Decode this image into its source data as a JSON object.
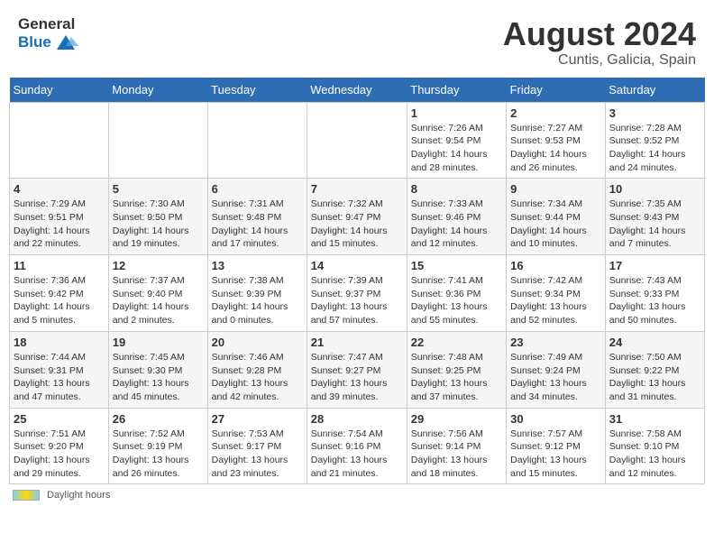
{
  "logo": {
    "general": "General",
    "blue": "Blue"
  },
  "title": "August 2024",
  "subtitle": "Cuntis, Galicia, Spain",
  "days_of_week": [
    "Sunday",
    "Monday",
    "Tuesday",
    "Wednesday",
    "Thursday",
    "Friday",
    "Saturday"
  ],
  "footer_label": "Daylight hours",
  "weeks": [
    [
      {
        "day": "",
        "info": ""
      },
      {
        "day": "",
        "info": ""
      },
      {
        "day": "",
        "info": ""
      },
      {
        "day": "",
        "info": ""
      },
      {
        "day": "1",
        "info": "Sunrise: 7:26 AM\nSunset: 9:54 PM\nDaylight: 14 hours and 28 minutes."
      },
      {
        "day": "2",
        "info": "Sunrise: 7:27 AM\nSunset: 9:53 PM\nDaylight: 14 hours and 26 minutes."
      },
      {
        "day": "3",
        "info": "Sunrise: 7:28 AM\nSunset: 9:52 PM\nDaylight: 14 hours and 24 minutes."
      }
    ],
    [
      {
        "day": "4",
        "info": "Sunrise: 7:29 AM\nSunset: 9:51 PM\nDaylight: 14 hours and 22 minutes."
      },
      {
        "day": "5",
        "info": "Sunrise: 7:30 AM\nSunset: 9:50 PM\nDaylight: 14 hours and 19 minutes."
      },
      {
        "day": "6",
        "info": "Sunrise: 7:31 AM\nSunset: 9:48 PM\nDaylight: 14 hours and 17 minutes."
      },
      {
        "day": "7",
        "info": "Sunrise: 7:32 AM\nSunset: 9:47 PM\nDaylight: 14 hours and 15 minutes."
      },
      {
        "day": "8",
        "info": "Sunrise: 7:33 AM\nSunset: 9:46 PM\nDaylight: 14 hours and 12 minutes."
      },
      {
        "day": "9",
        "info": "Sunrise: 7:34 AM\nSunset: 9:44 PM\nDaylight: 14 hours and 10 minutes."
      },
      {
        "day": "10",
        "info": "Sunrise: 7:35 AM\nSunset: 9:43 PM\nDaylight: 14 hours and 7 minutes."
      }
    ],
    [
      {
        "day": "11",
        "info": "Sunrise: 7:36 AM\nSunset: 9:42 PM\nDaylight: 14 hours and 5 minutes."
      },
      {
        "day": "12",
        "info": "Sunrise: 7:37 AM\nSunset: 9:40 PM\nDaylight: 14 hours and 2 minutes."
      },
      {
        "day": "13",
        "info": "Sunrise: 7:38 AM\nSunset: 9:39 PM\nDaylight: 14 hours and 0 minutes."
      },
      {
        "day": "14",
        "info": "Sunrise: 7:39 AM\nSunset: 9:37 PM\nDaylight: 13 hours and 57 minutes."
      },
      {
        "day": "15",
        "info": "Sunrise: 7:41 AM\nSunset: 9:36 PM\nDaylight: 13 hours and 55 minutes."
      },
      {
        "day": "16",
        "info": "Sunrise: 7:42 AM\nSunset: 9:34 PM\nDaylight: 13 hours and 52 minutes."
      },
      {
        "day": "17",
        "info": "Sunrise: 7:43 AM\nSunset: 9:33 PM\nDaylight: 13 hours and 50 minutes."
      }
    ],
    [
      {
        "day": "18",
        "info": "Sunrise: 7:44 AM\nSunset: 9:31 PM\nDaylight: 13 hours and 47 minutes."
      },
      {
        "day": "19",
        "info": "Sunrise: 7:45 AM\nSunset: 9:30 PM\nDaylight: 13 hours and 45 minutes."
      },
      {
        "day": "20",
        "info": "Sunrise: 7:46 AM\nSunset: 9:28 PM\nDaylight: 13 hours and 42 minutes."
      },
      {
        "day": "21",
        "info": "Sunrise: 7:47 AM\nSunset: 9:27 PM\nDaylight: 13 hours and 39 minutes."
      },
      {
        "day": "22",
        "info": "Sunrise: 7:48 AM\nSunset: 9:25 PM\nDaylight: 13 hours and 37 minutes."
      },
      {
        "day": "23",
        "info": "Sunrise: 7:49 AM\nSunset: 9:24 PM\nDaylight: 13 hours and 34 minutes."
      },
      {
        "day": "24",
        "info": "Sunrise: 7:50 AM\nSunset: 9:22 PM\nDaylight: 13 hours and 31 minutes."
      }
    ],
    [
      {
        "day": "25",
        "info": "Sunrise: 7:51 AM\nSunset: 9:20 PM\nDaylight: 13 hours and 29 minutes."
      },
      {
        "day": "26",
        "info": "Sunrise: 7:52 AM\nSunset: 9:19 PM\nDaylight: 13 hours and 26 minutes."
      },
      {
        "day": "27",
        "info": "Sunrise: 7:53 AM\nSunset: 9:17 PM\nDaylight: 13 hours and 23 minutes."
      },
      {
        "day": "28",
        "info": "Sunrise: 7:54 AM\nSunset: 9:16 PM\nDaylight: 13 hours and 21 minutes."
      },
      {
        "day": "29",
        "info": "Sunrise: 7:56 AM\nSunset: 9:14 PM\nDaylight: 13 hours and 18 minutes."
      },
      {
        "day": "30",
        "info": "Sunrise: 7:57 AM\nSunset: 9:12 PM\nDaylight: 13 hours and 15 minutes."
      },
      {
        "day": "31",
        "info": "Sunrise: 7:58 AM\nSunset: 9:10 PM\nDaylight: 13 hours and 12 minutes."
      }
    ]
  ]
}
